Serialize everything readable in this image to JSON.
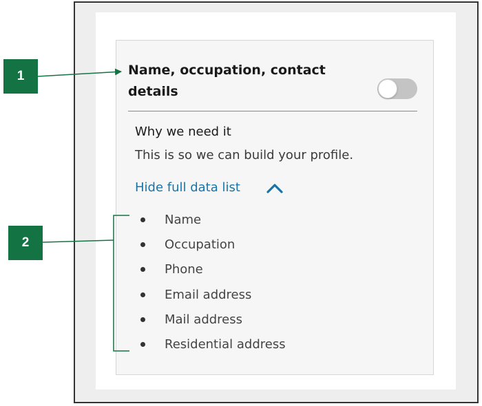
{
  "annotations": {
    "callout_1": "1",
    "callout_2": "2",
    "color": "#137343"
  },
  "card": {
    "title": "Name, occupation, contact details",
    "toggle": {
      "state": "off"
    },
    "why_heading": "Why we need it",
    "why_text": "This is so we can build your profile.",
    "hide_link": "Hide full data list",
    "link_icon": "chevron-up-icon",
    "data_items": [
      {
        "label": "Name"
      },
      {
        "label": "Occupation"
      },
      {
        "label": "Phone"
      },
      {
        "label": "Email address"
      },
      {
        "label": "Mail address"
      },
      {
        "label": "Residential address"
      }
    ]
  }
}
